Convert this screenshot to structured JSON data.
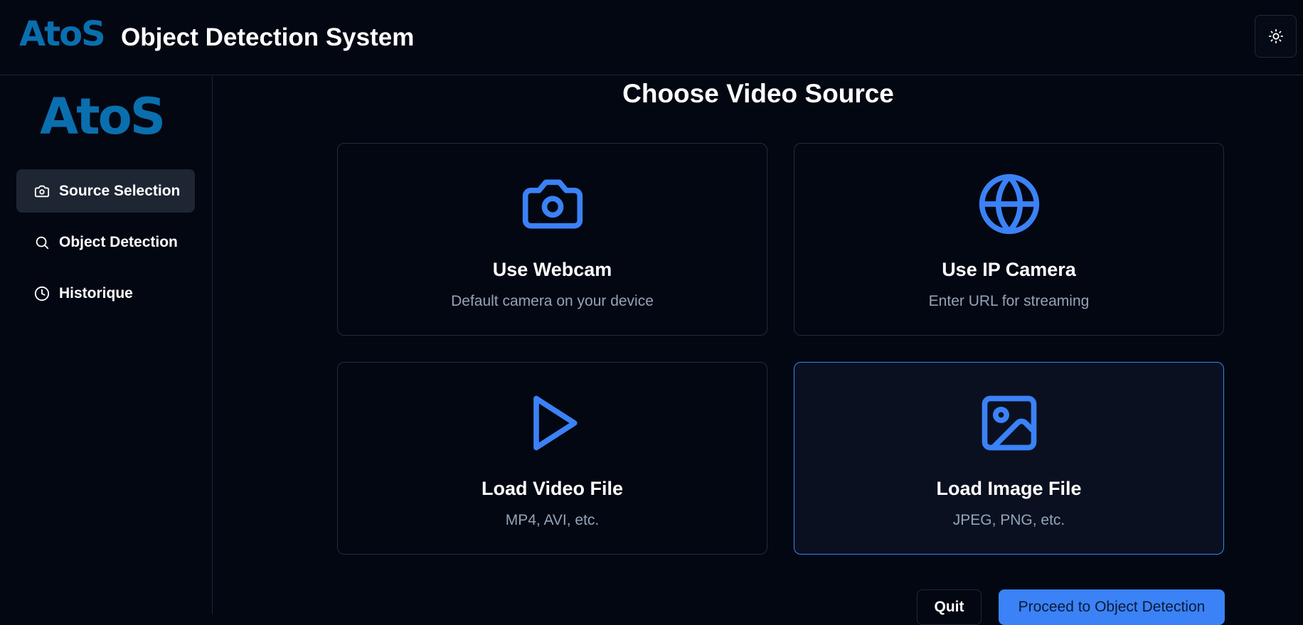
{
  "header": {
    "logo_text": "AtoS",
    "title": "Object Detection System",
    "theme_toggle_icon": "sun-icon"
  },
  "sidebar": {
    "logo_text": "AtoS",
    "items": [
      {
        "label": "Source Selection",
        "icon": "camera-icon",
        "active": true
      },
      {
        "label": "Object Detection",
        "icon": "search-icon",
        "active": false
      },
      {
        "label": "Historique",
        "icon": "clock-icon",
        "active": false
      }
    ]
  },
  "main": {
    "title": "Choose Video Source",
    "cards": [
      {
        "title": "Use Webcam",
        "subtitle": "Default camera on your device",
        "icon": "camera-icon",
        "selected": false
      },
      {
        "title": "Use IP Camera",
        "subtitle": "Enter URL for streaming",
        "icon": "globe-icon",
        "selected": false
      },
      {
        "title": "Load Video File",
        "subtitle": "MP4, AVI, etc.",
        "icon": "play-icon",
        "selected": false
      },
      {
        "title": "Load Image File",
        "subtitle": "JPEG, PNG, etc.",
        "icon": "image-icon",
        "selected": true
      }
    ],
    "quit_label": "Quit",
    "proceed_label": "Proceed to Object Detection"
  },
  "colors": {
    "background": "#030712",
    "accent": "#3b82f6",
    "brand": "#0a6fae",
    "muted_text": "#94a3b8"
  }
}
